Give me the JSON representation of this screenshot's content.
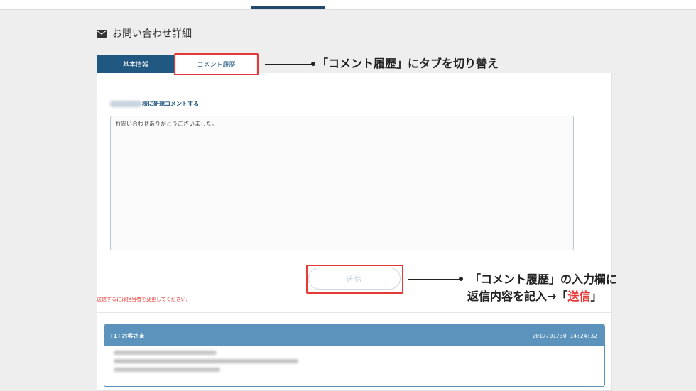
{
  "page": {
    "title": "お問い合わせ詳細",
    "title_icon": "envelope-icon"
  },
  "tabs": [
    {
      "label": "基本情報",
      "active": false
    },
    {
      "label": "コメント履歴",
      "active": true
    }
  ],
  "compose": {
    "label_suffix": "様に新規コメントする",
    "textarea_value": "お問い合わせありがとうございました。",
    "send_label": "送信",
    "warning": "送信するには担当者を変更してください。"
  },
  "history": [
    {
      "author": "[1] お客さま",
      "date": "2017/01/30 14:24:32"
    }
  ],
  "annotations": {
    "tab_callout": "「コメント履歴」にタブを切り替え",
    "send_callout_line1": "「コメント履歴」の入力欄に",
    "send_callout_line2_prefix": "返信内容を記入→「",
    "send_callout_line2_highlight": "送信",
    "send_callout_line2_suffix": "」"
  },
  "colors": {
    "primary": "#215881",
    "history_header": "#5b93bd",
    "highlight": "#e53935",
    "page_background": "#eeeeee"
  }
}
